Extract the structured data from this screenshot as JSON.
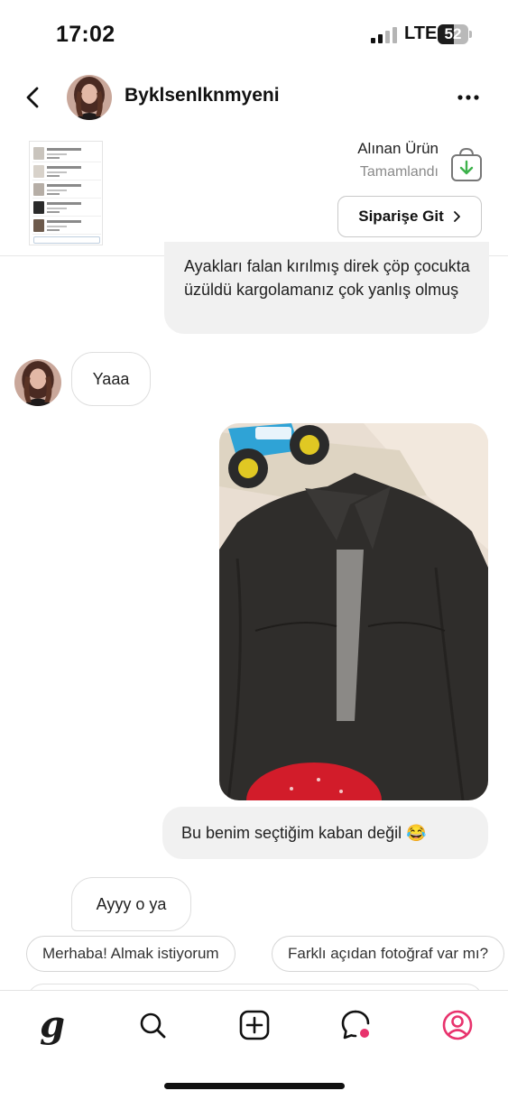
{
  "status_bar": {
    "time": "17:02",
    "network": "LTE",
    "battery_level": "52",
    "battery_fraction": 0.52
  },
  "header": {
    "username": "Byklsenlknmyeni"
  },
  "order": {
    "title": "Alınan Ürün",
    "status": "Tamamlandı",
    "button_label": "Siparişe Git"
  },
  "messages": [
    {
      "sender": "me",
      "text": "Ayakları falan kırılmış direk çöp çocukta üzüldü kargolamanız çok yanlış olmuş"
    },
    {
      "sender": "them",
      "text": "Yaaa"
    },
    {
      "sender": "me",
      "type": "image"
    },
    {
      "sender": "me",
      "text": "Bu benim seçtiğim kaban değil 😂"
    },
    {
      "sender": "them",
      "text": "Ayyy o ya"
    }
  ],
  "quick_replies": [
    "Merhaba! Almak istiyorum",
    "Farklı açıdan fotoğraf var mı?"
  ],
  "nav": {
    "home_logo": "g",
    "items": [
      "home-icon",
      "search-icon",
      "add-icon",
      "messages-icon",
      "profile-icon"
    ],
    "accent": "#e8336d"
  }
}
